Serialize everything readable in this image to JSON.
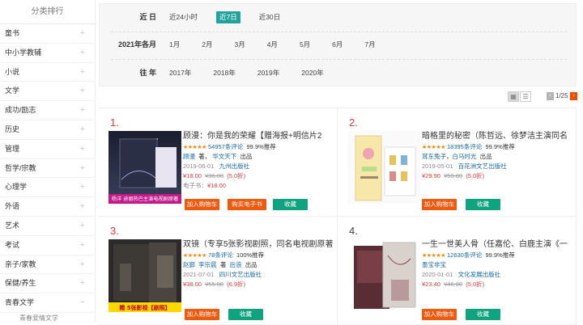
{
  "sidebar": {
    "title": "分类排行",
    "items": [
      "童书",
      "中小学教辅",
      "小说",
      "文学",
      "成功/励志",
      "历史",
      "管理",
      "哲学/宗教",
      "心理学",
      "外语",
      "艺术",
      "考试",
      "亲子/家教",
      "保健/养生",
      "青春文学"
    ],
    "plus": "+",
    "minus": "−",
    "sub": "青春爱情文学"
  },
  "filters": {
    "recent": {
      "label": "近 日",
      "options": [
        "近24小时",
        "近7日",
        "近30日"
      ],
      "active": "近7日"
    },
    "month": {
      "label": "2021年各月",
      "options": [
        "1月",
        "2月",
        "3月",
        "4月",
        "5月",
        "6月",
        "7月"
      ]
    },
    "year": {
      "label": "往 年",
      "options": [
        "2017年",
        "2018年",
        "2019年",
        "2020年"
      ]
    }
  },
  "toolbar": {
    "grid_icon": "grid-view-icon",
    "list_icon": "list-view-icon",
    "page": "1/25",
    "prev": "‹",
    "next": "›"
  },
  "books": [
    {
      "rank": "1.",
      "title": "顾漫：你是我的荣耀【赠海报+明信片2",
      "reviews": "54957条评论",
      "recommend": "99.9%推荐",
      "author": "顾漫",
      "author_suffix": "著，",
      "publisher_short": "华文天下",
      "publish_word": "出品",
      "date": "2019-06-01",
      "press": "九州出版社",
      "price": "¥18.00",
      "orig": "¥36.00",
      "discount": "(5.0折)",
      "ebook_label": "电子书：",
      "ebook_price": "¥18.00",
      "cover_caption": "杨洋 迪丽热巴主演电视剧原著",
      "cart_label": "加入购物车",
      "ebook_btn": "购买电子书",
      "fav_label": "收藏"
    },
    {
      "rank": "2.",
      "title": "暗格里的秘密（陈哲远、徐梦洁主演同名",
      "reviews": "18395条评论",
      "recommend": "99.9%推荐",
      "author": "耳东兔子",
      "author_suffix": "，",
      "publisher_short": "白马时光",
      "publish_word": "出品",
      "date": "2019-05-01",
      "press": "百花洲文艺出版社",
      "price": "¥29.90",
      "orig": "¥59.80",
      "discount": "(5.0折)",
      "cart_label": "加入购物车",
      "fav_label": "收藏"
    },
    {
      "rank": "3.",
      "title": "双镜（专享5张影视剧照，同名电视剧原著",
      "reviews": "78条评论",
      "recommend": "100%推荐",
      "author": "赵鄞",
      "author2": "李宗晨",
      "author_suffix": "著",
      "publisher_short": "后浪",
      "publish_word": "出品",
      "date": "2021-07-01",
      "press": "四川文艺出版社",
      "price": "¥38.00",
      "orig": "¥55.00",
      "discount": "(6.9折)",
      "cover_caption": "赠 5张影视【剧照】",
      "cart_label": "加入购物车",
      "fav_label": "收藏"
    },
    {
      "rank": "4.",
      "title": "一生一世美人骨（任嘉伦、白鹿主演《一",
      "reviews": "12630条评论",
      "recommend": "99.9%推荐",
      "author": "墨宝非宝",
      "date": "2020-01-01",
      "press": "文化发展出版社",
      "price": "¥23.40",
      "orig": "¥46.80",
      "discount": "(5.0折)",
      "cart_label": "加入购物车",
      "fav_label": "收藏"
    }
  ],
  "stars": "★★★★★",
  "colors": {
    "accent": "#1fa39b",
    "price": "#e4393c",
    "cart": "#f05a0f",
    "fav": "#10a37f",
    "link": "#1668ac"
  }
}
